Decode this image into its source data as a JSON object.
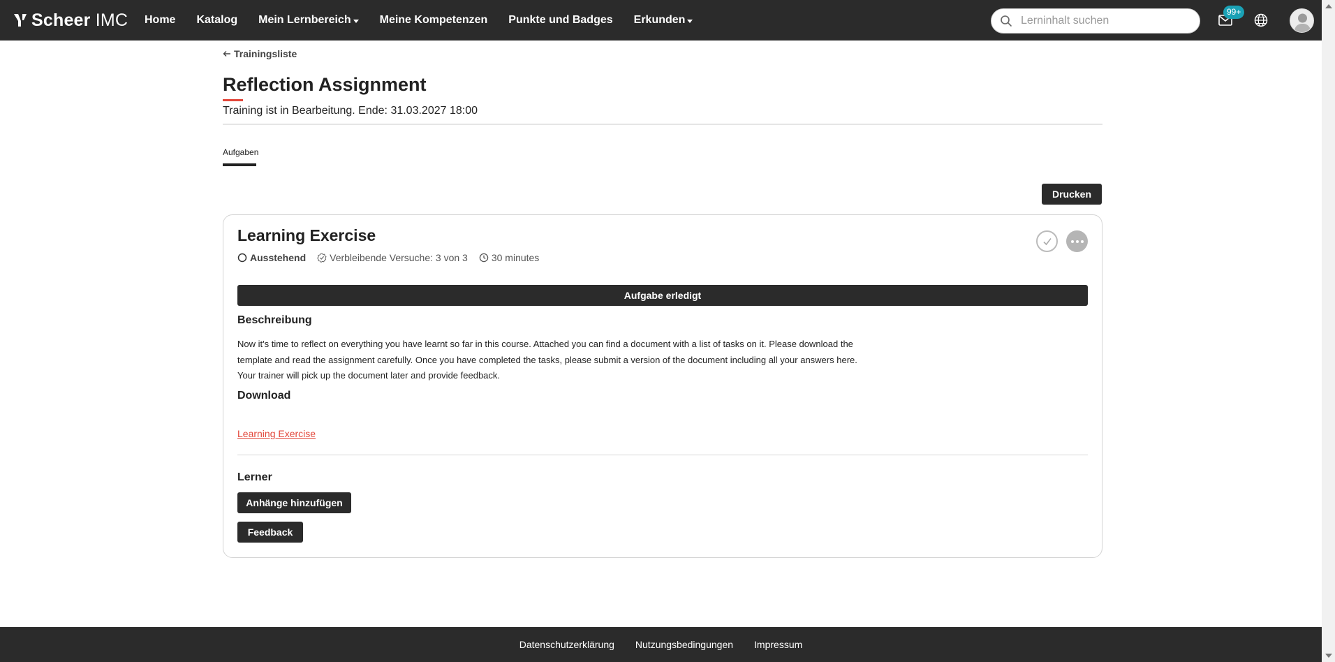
{
  "brand": {
    "name_bold": "Scheer",
    "name_thin": "IMC"
  },
  "nav": {
    "items": [
      {
        "label": "Home",
        "has_caret": false
      },
      {
        "label": "Katalog",
        "has_caret": false
      },
      {
        "label": "Mein Lernbereich",
        "has_caret": true
      },
      {
        "label": "Meine Kompetenzen",
        "has_caret": false
      },
      {
        "label": "Punkte und Badges",
        "has_caret": false
      },
      {
        "label": "Erkunden",
        "has_caret": true
      }
    ]
  },
  "search": {
    "placeholder": "Lerninhalt suchen",
    "value": ""
  },
  "notifications": {
    "count": "99+"
  },
  "icons": {
    "search": "search-icon",
    "mail": "mail-icon",
    "globe": "globe-icon",
    "avatar": "user-avatar",
    "back": "arrow-left-icon",
    "pending": "circle-icon",
    "attempts": "check-badge-icon",
    "duration": "clock-icon",
    "complete": "check-circle-icon",
    "more": "more-icon"
  },
  "colors": {
    "accent": "#e2463a",
    "dark": "#2b2b2b",
    "badge": "#1aa1b5"
  },
  "breadcrumb": {
    "back_label": "Trainingsliste"
  },
  "page": {
    "title": "Reflection Assignment",
    "status": "Training ist in Bearbeitung. Ende: 31.03.2027 18:00"
  },
  "tabs": [
    {
      "label": "Aufgaben",
      "active": true
    }
  ],
  "toolbar": {
    "print_label": "Drucken"
  },
  "task": {
    "title": "Learning Exercise",
    "state": "Ausstehend",
    "attempts": "Verbleibende Versuche: 3 von 3",
    "duration": "30 minutes",
    "complete_button": "Aufgabe erledigt",
    "description_heading": "Beschreibung",
    "description_lines": [
      "Now it's time to reflect on everything you have learnt so far in this course. Attached you can find a document with a list of tasks on it. Please download the",
      "template and read the assignment carefully. Once you have completed the tasks, please submit a version of the document including all your answers here.",
      "Your trainer will pick up the document later and provide feedback."
    ],
    "download_heading": "Download",
    "download_link": "Learning Exercise",
    "learner_heading": "Lerner",
    "attach_button": "Anhänge hinzufügen",
    "feedback_button": "Feedback"
  },
  "footer": {
    "links": [
      "Datenschutzerklärung",
      "Nutzungsbedingungen",
      "Impressum"
    ]
  }
}
